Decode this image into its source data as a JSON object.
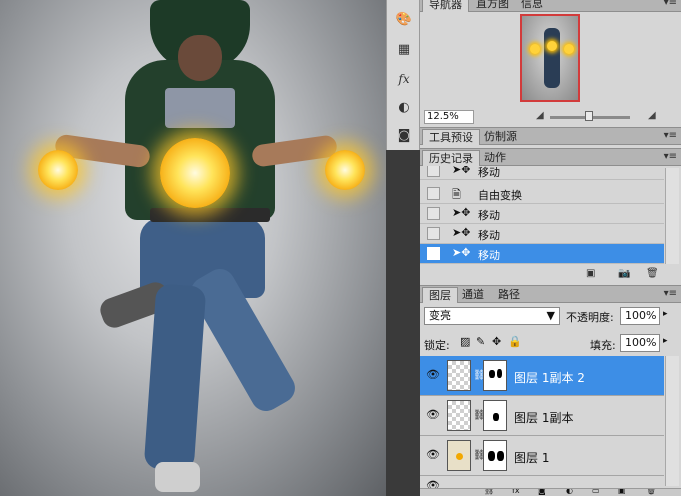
{
  "navigator": {
    "tabs": [
      "导航器",
      "直方图",
      "信息"
    ],
    "zoom": "12.5%"
  },
  "tool_presets": {
    "tabs": [
      "工具预设",
      "仿制源"
    ]
  },
  "history": {
    "tabs": [
      "历史记录",
      "动作"
    ],
    "items": [
      {
        "label": "移动",
        "icon": "move-tool-icon"
      },
      {
        "label": "自由变换",
        "icon": "transform-doc-icon"
      },
      {
        "label": "移动",
        "icon": "move-tool-icon"
      },
      {
        "label": "移动",
        "icon": "move-tool-icon"
      },
      {
        "label": "移动",
        "icon": "move-tool-icon",
        "selected": true
      }
    ]
  },
  "layers": {
    "tabs": [
      "图层",
      "通道",
      "路径"
    ],
    "blend_mode": "变亮",
    "opacity_label": "不透明度:",
    "opacity": "100%",
    "lock_label": "锁定:",
    "fill_label": "填充:",
    "fill": "100%",
    "items": [
      {
        "name": "图层 1副本 2",
        "selected": true
      },
      {
        "name": "图层 1副本",
        "selected": false
      },
      {
        "name": "图层 1",
        "selected": false
      }
    ]
  },
  "colors": {
    "selection": "#3d8ee6",
    "panel_bg": "#d6d6d6"
  }
}
